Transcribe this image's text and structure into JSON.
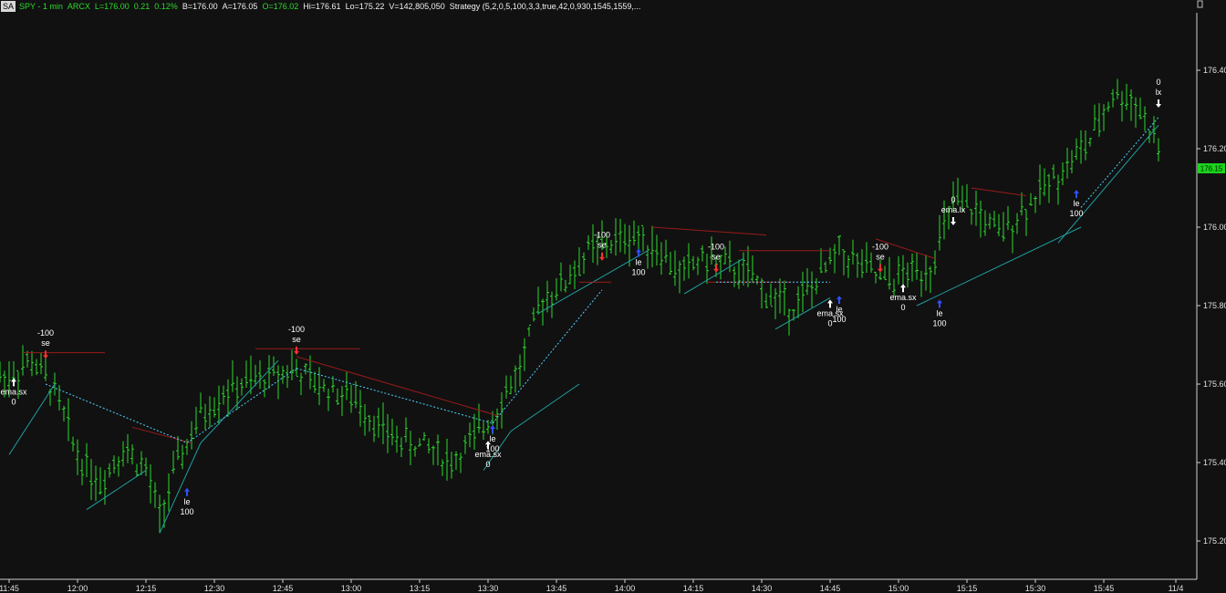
{
  "header": {
    "badge": "SA",
    "symbol": "SPY - 1 min",
    "exchange": "ARCX",
    "last": "L=176.00",
    "change": "0.21",
    "change_pct": "0.12%",
    "bid": "B=176.00",
    "ask": "A=176.05",
    "open": "O=176.02",
    "high": "Hi=176.61",
    "low": "Lo=175.22",
    "volume": "V=142,805,050",
    "strategy": "Strategy (5,2,0,5,100,3,3,true,42,0,930,1545,1559,..."
  },
  "colors": {
    "background": "#111111",
    "bar": "#2cd92c",
    "axis_text": "#e0e0e0",
    "trend_up": "#1fa0a0",
    "trend_down": "#9a1a1a",
    "signal_dotted": "#4fd0ff",
    "last_price_bg": "#1dd31d"
  },
  "chart_data": {
    "type": "ohlc",
    "symbol": "SPY",
    "interval": "1 min",
    "yaxis_ticks": [
      "176.40",
      "176.20",
      "176.00",
      "175.80",
      "175.60",
      "175.40",
      "175.20"
    ],
    "ylim": [
      175.15,
      176.48
    ],
    "xaxis_ticks": [
      "11:45",
      "12:00",
      "12:15",
      "12:30",
      "12:45",
      "13:00",
      "13:15",
      "13:30",
      "13:45",
      "14:00",
      "14:15",
      "14:30",
      "14:45",
      "15:00",
      "15:15",
      "15:30",
      "15:45",
      "11/4"
    ],
    "last_price_label": "176.15",
    "series": [
      {
        "time": "11:45",
        "value": 175.62
      },
      {
        "time": "11:50",
        "value": 175.66
      },
      {
        "time": "11:55",
        "value": 175.58
      },
      {
        "time": "12:00",
        "value": 175.42
      },
      {
        "time": "12:05",
        "value": 175.35
      },
      {
        "time": "12:10",
        "value": 175.44
      },
      {
        "time": "12:15",
        "value": 175.38
      },
      {
        "time": "12:18",
        "value": 175.26
      },
      {
        "time": "12:22",
        "value": 175.4
      },
      {
        "time": "12:27",
        "value": 175.52
      },
      {
        "time": "12:32",
        "value": 175.58
      },
      {
        "time": "12:37",
        "value": 175.6
      },
      {
        "time": "12:42",
        "value": 175.62
      },
      {
        "time": "12:47",
        "value": 175.64
      },
      {
        "time": "12:52",
        "value": 175.6
      },
      {
        "time": "12:57",
        "value": 175.58
      },
      {
        "time": "13:02",
        "value": 175.55
      },
      {
        "time": "13:07",
        "value": 175.48
      },
      {
        "time": "13:12",
        "value": 175.45
      },
      {
        "time": "13:17",
        "value": 175.44
      },
      {
        "time": "13:22",
        "value": 175.4
      },
      {
        "time": "13:27",
        "value": 175.46
      },
      {
        "time": "13:32",
        "value": 175.54
      },
      {
        "time": "13:37",
        "value": 175.64
      },
      {
        "time": "13:42",
        "value": 175.82
      },
      {
        "time": "13:47",
        "value": 175.86
      },
      {
        "time": "13:52",
        "value": 175.94
      },
      {
        "time": "13:57",
        "value": 175.96
      },
      {
        "time": "14:02",
        "value": 175.98
      },
      {
        "time": "14:07",
        "value": 175.95
      },
      {
        "time": "14:12",
        "value": 175.88
      },
      {
        "time": "14:17",
        "value": 175.92
      },
      {
        "time": "14:22",
        "value": 175.9
      },
      {
        "time": "14:27",
        "value": 175.88
      },
      {
        "time": "14:32",
        "value": 175.82
      },
      {
        "time": "14:37",
        "value": 175.8
      },
      {
        "time": "14:42",
        "value": 175.86
      },
      {
        "time": "14:47",
        "value": 175.94
      },
      {
        "time": "14:52",
        "value": 175.9
      },
      {
        "time": "14:57",
        "value": 175.86
      },
      {
        "time": "15:02",
        "value": 175.88
      },
      {
        "time": "15:07",
        "value": 175.9
      },
      {
        "time": "15:12",
        "value": 176.06
      },
      {
        "time": "15:17",
        "value": 176.04
      },
      {
        "time": "15:22",
        "value": 175.98
      },
      {
        "time": "15:27",
        "value": 176.04
      },
      {
        "time": "15:32",
        "value": 176.1
      },
      {
        "time": "15:37",
        "value": 176.16
      },
      {
        "time": "15:42",
        "value": 176.22
      },
      {
        "time": "15:47",
        "value": 176.34
      },
      {
        "time": "15:52",
        "value": 176.32
      },
      {
        "time": "15:57",
        "value": 176.2
      }
    ],
    "signals": [
      {
        "label": "ema.sx",
        "qty": "0",
        "dir": "up",
        "time": "11:46",
        "price": 175.62
      },
      {
        "label": "se",
        "qty": "-100",
        "dir": "down",
        "time": "11:53",
        "price": 175.66
      },
      {
        "label": "le",
        "qty": "100",
        "dir": "up",
        "time": "12:24",
        "price": 175.34
      },
      {
        "label": "se",
        "qty": "-100",
        "dir": "down",
        "time": "12:48",
        "price": 175.67
      },
      {
        "label": "ema.sx",
        "qty": "0",
        "dir": "up",
        "time": "13:30",
        "price": 175.46
      },
      {
        "label": "le",
        "qty": "100",
        "dir": "up",
        "time": "13:31",
        "price": 175.5
      },
      {
        "label": "se",
        "qty": "-100",
        "dir": "down",
        "time": "13:55",
        "price": 175.91
      },
      {
        "label": "le",
        "qty": "100",
        "dir": "up",
        "time": "14:03",
        "price": 175.95
      },
      {
        "label": "se",
        "qty": "-100",
        "dir": "down",
        "time": "14:20",
        "price": 175.88
      },
      {
        "label": "ema.sx",
        "qty": "0",
        "dir": "up",
        "time": "14:45",
        "price": 175.82
      },
      {
        "label": "le",
        "qty": "100",
        "dir": "up",
        "time": "14:47",
        "price": 175.83
      },
      {
        "label": "se",
        "qty": "-100",
        "dir": "down",
        "time": "14:56",
        "price": 175.88
      },
      {
        "label": "ema.sx",
        "qty": "0",
        "dir": "up",
        "time": "15:01",
        "price": 175.86
      },
      {
        "label": "le",
        "qty": "100",
        "dir": "up",
        "time": "15:09",
        "price": 175.82
      },
      {
        "label": "ema.lx",
        "qty": "0",
        "dir": "down",
        "time": "15:12",
        "price": 176.0
      },
      {
        "label": "le",
        "qty": "100",
        "dir": "up",
        "time": "15:39",
        "price": 176.1
      },
      {
        "label": "lx",
        "qty": "0",
        "dir": "down",
        "time": "15:57",
        "price": 176.3
      }
    ]
  }
}
